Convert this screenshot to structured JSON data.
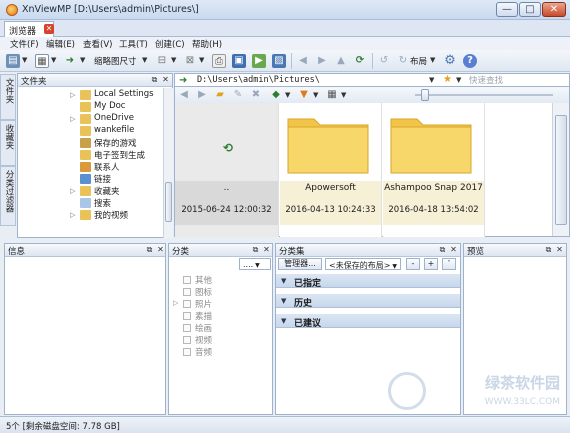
{
  "window": {
    "title": "XnViewMP [D:\\Users\\admin\\Pictures\\]",
    "minimize": "—",
    "maximize": "□",
    "close": "✕"
  },
  "tab": {
    "label": "浏览器",
    "close": "✕"
  },
  "menu": [
    "文件(F)",
    "编辑(E)",
    "查看(V)",
    "工具(T)",
    "创建(C)",
    "帮助(H)"
  ],
  "toolbar": {
    "thumb_size_label": "缩略图尺寸",
    "layout_label": "布局"
  },
  "side_tabs": [
    "文件夹",
    "收藏夹",
    "分类过滤器"
  ],
  "folders_panel": {
    "title": "文件夹",
    "items": [
      {
        "label": "Local Settings",
        "icon": "folder-settings-icon",
        "color": "#e9c35a",
        "arrow": "▷"
      },
      {
        "label": "My Doc",
        "icon": "folder-doc-icon",
        "color": "#e9c35a",
        "arrow": ""
      },
      {
        "label": "OneDrive",
        "icon": "onedrive-icon",
        "color": "#e9c35a",
        "arrow": "▷"
      },
      {
        "label": "wankefile",
        "icon": "folder-icon",
        "color": "#e9c35a",
        "arrow": ""
      },
      {
        "label": "保存的游戏",
        "icon": "saved-games-icon",
        "color": "#c8a04a",
        "arrow": ""
      },
      {
        "label": "电子签到生成",
        "icon": "folder-icon",
        "color": "#e9c35a",
        "arrow": ""
      },
      {
        "label": "联系人",
        "icon": "contacts-icon",
        "color": "#d89a3c",
        "arrow": ""
      },
      {
        "label": "链接",
        "icon": "links-icon",
        "color": "#5a8fd1",
        "arrow": ""
      },
      {
        "label": "收藏夹",
        "icon": "favorites-folder-icon",
        "color": "#e9c35a",
        "arrow": "▷"
      },
      {
        "label": "搜索",
        "icon": "search-folder-icon",
        "color": "#a9c6e8",
        "arrow": ""
      },
      {
        "label": "我的视频",
        "icon": "videos-folder-icon",
        "color": "#e9c35a",
        "arrow": "▷"
      }
    ]
  },
  "address": {
    "path": "D:\\Users\\admin\\Pictures\\",
    "search_placeholder": "快速查找"
  },
  "thumbnails": [
    {
      "name": "..",
      "date": "2015-06-24 12:00:32",
      "type": "parent"
    },
    {
      "name": "Apowersoft",
      "date": "2016-04-13 10:24:33",
      "type": "folder"
    },
    {
      "name": "Ashampoo Snap 2017",
      "date": "2016-04-18 13:54:02",
      "type": "folder"
    }
  ],
  "info_panel": {
    "title": "信息"
  },
  "category_panel": {
    "title": "分类",
    "dropdown_value": "....",
    "items": [
      "其他",
      "图标",
      "照片",
      "素描",
      "绘画",
      "视频",
      "音频"
    ]
  },
  "category_sets_panel": {
    "title": "分类集",
    "manager_label": "管理器...",
    "layout_value": "<未保存的布局>",
    "minus": "-",
    "plus": "+",
    "sets": [
      "已指定",
      "历史",
      "已建议"
    ]
  },
  "preview_panel": {
    "title": "预览"
  },
  "status": {
    "text": "5个 [剩余磁盘空间: 7.78 GB]"
  },
  "watermark": {
    "text": "绿茶软件园",
    "url": "WWW.33LC.COM"
  },
  "colors": {
    "folder": "#f5cd52",
    "selection": "#f5f0d6",
    "accent": "#2e7d32"
  }
}
